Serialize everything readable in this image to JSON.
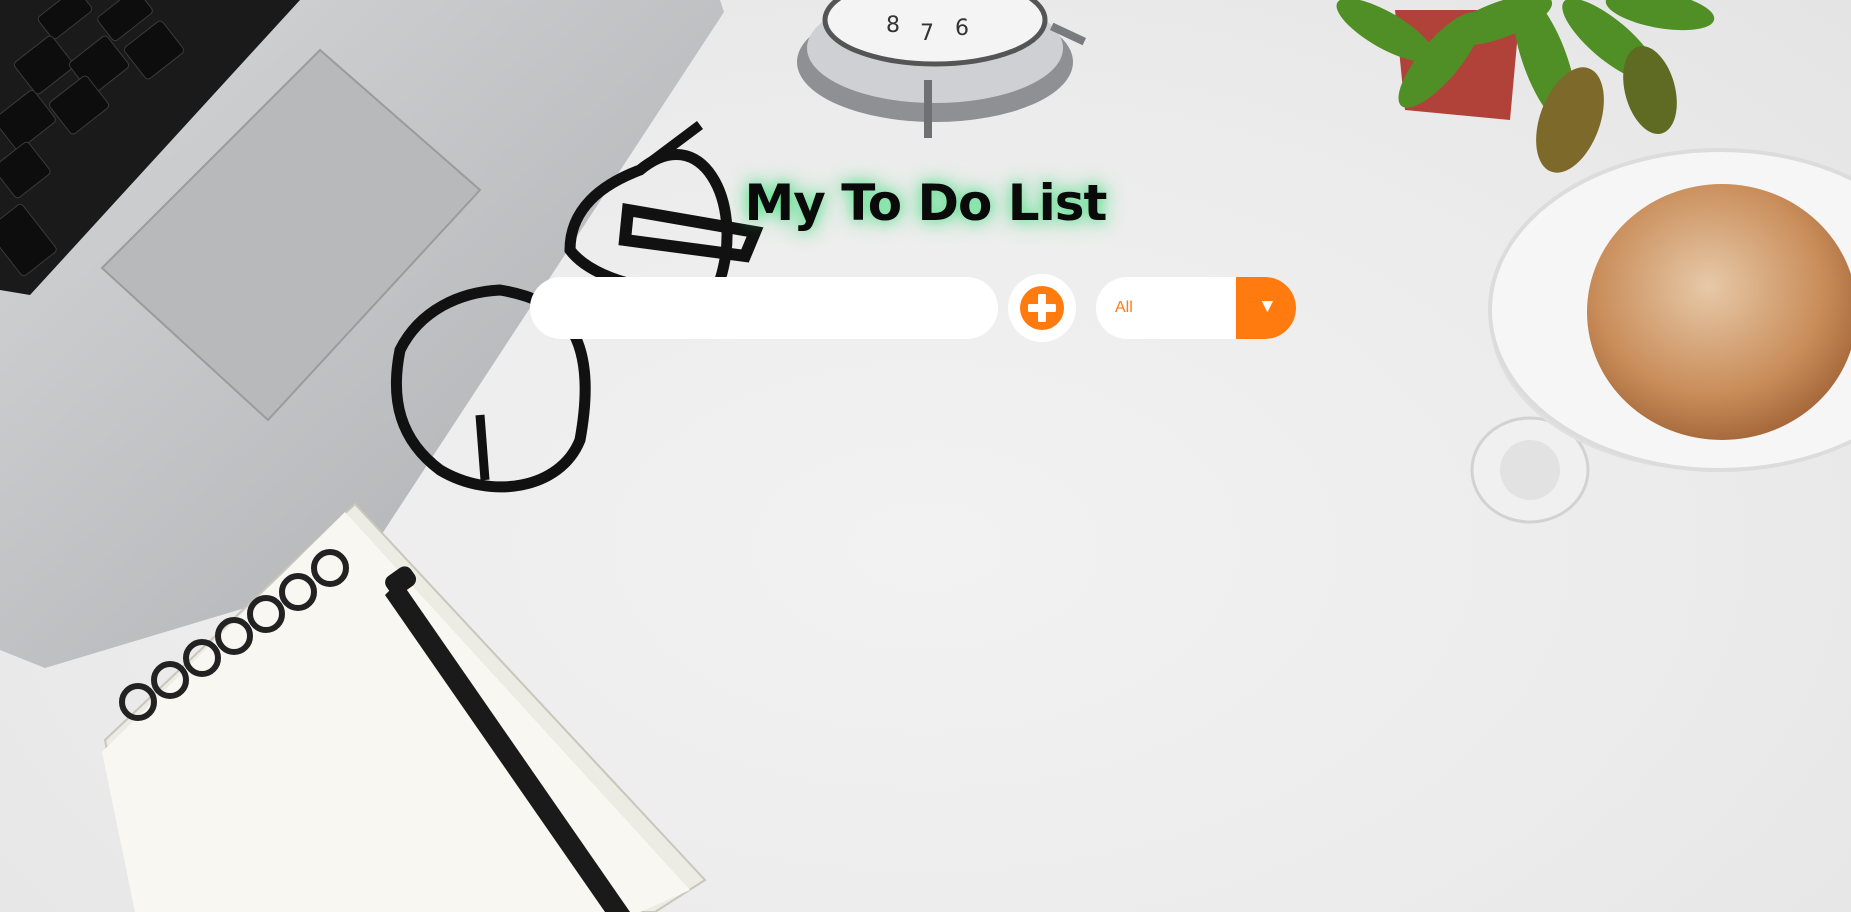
{
  "page": {
    "title": "My To Do List"
  },
  "todo_input": {
    "value": "",
    "placeholder": ""
  },
  "add_button": {
    "icon": "plus-circle-icon"
  },
  "filter": {
    "selected": "All",
    "icon": "dropdown-arrow-icon",
    "arrow_glyph": "▼"
  },
  "colors": {
    "accent": "#ff7b10",
    "title_glow": "#28dc6e",
    "background": "#ececec"
  }
}
